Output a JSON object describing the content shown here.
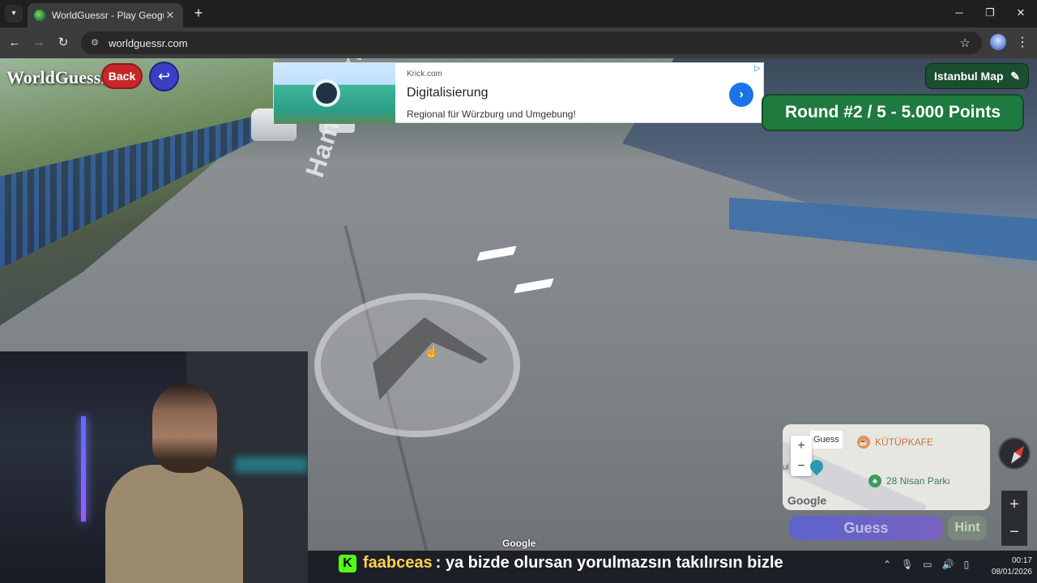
{
  "browser": {
    "tab_title": "WorldGuessr - Play Geoguessr Free",
    "url": "worldguessr.com",
    "new_tab": "+",
    "minimize": "─",
    "maximize": "❐",
    "close": "✕"
  },
  "game": {
    "brand": "WorldGuessr",
    "back_label": "Back",
    "undo_icon": "↩",
    "map_name": "Istanbul Map",
    "edit_icon": "✎",
    "round_info": "Round #2 / 5 - 5.000 Points",
    "street_name": "Hamamönden Sok.",
    "google_watermark": "Google",
    "guess_label": "Guess",
    "hint_label": "Hint"
  },
  "ad": {
    "host": "Krick.com",
    "title": "Digitalisierung",
    "description": "Regional für Würzburg und Umgebung!",
    "cta_icon": "›",
    "adchoice": "▷"
  },
  "minimap": {
    "zoom_in": "+",
    "zoom_out": "−",
    "guess_label": "Guess",
    "poi_1": "KÜTÜPKAFE",
    "poi_2": "28 Nisan Parkı",
    "google_logo": "Google",
    "side_label": "ul"
  },
  "streetview_zoom": {
    "zoom_in": "+",
    "zoom_out": "−"
  },
  "chat": {
    "badge": "K",
    "username": "faabceas",
    "message": ": ya bizde olursan yorulmazsın takılırsın bizle"
  },
  "system": {
    "time": "00:17",
    "date": "08/01/2026"
  },
  "colors": {
    "round_bg": "#1f7a3f",
    "back_bg": "#c62828",
    "guess_bg": "#5a63d6",
    "ad_button": "#1a73e8"
  }
}
